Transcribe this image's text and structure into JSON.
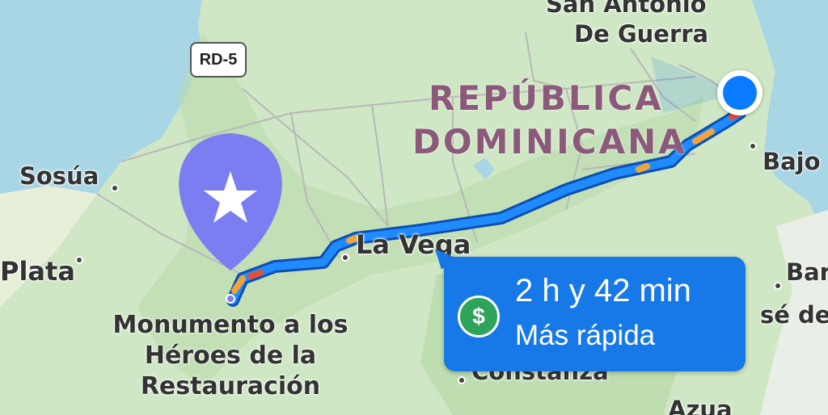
{
  "map": {
    "route_time": "2 h y 42 min",
    "route_kind": "Más rápida",
    "route_cost_icon": "dollar-icon",
    "route_cost_symbol": "$",
    "road_shield": "RD-5",
    "country_line1": "REPÚBLICA",
    "country_line2": "DOMINICANA",
    "places": {
      "san_antonio": "San Antonio",
      "de_guerra": "De Guerra",
      "sosua": "Sosúa",
      "plata": "Plata",
      "la_vega": "La Vega",
      "bajo": "Bajo",
      "bar": "Bar",
      "se_de": "sé de",
      "constanza": "Constanza",
      "azua": "Azua"
    },
    "destination_label": "Monumento a los Héroes de la Restauración",
    "destination_icon": "star-icon",
    "colors": {
      "route": "#1778e8",
      "user_location": "#0a7aff",
      "destination_pin": "#7b7ef0",
      "cost_badge": "#2ea35a",
      "country_label": "#8b5a7a"
    }
  }
}
